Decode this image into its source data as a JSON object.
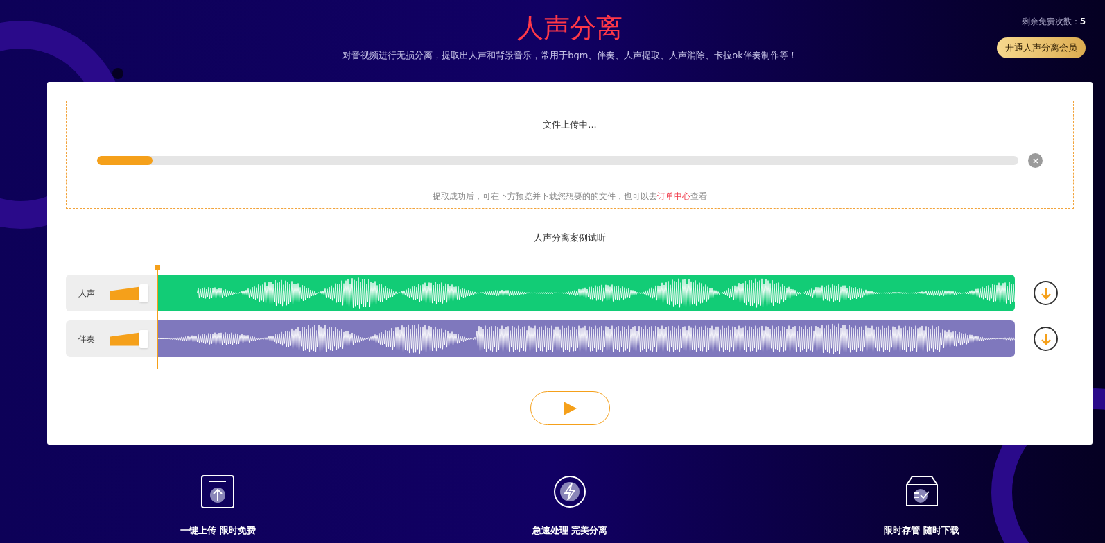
{
  "header": {
    "title": "人声分离",
    "subtitle": "对音视频进行无损分离，提取出人声和背景音乐，常用于bgm、伴奏、人声提取、人声消除、卡拉ok伴奏制作等！",
    "remaining_label": "剩余免费次数：",
    "remaining_count": "5",
    "member_button": "开通人声分离会员"
  },
  "upload": {
    "status": "文件上传中...",
    "level": 0.06,
    "hint_before": "提取成功后，可在下方预览并下载您想要的的文件，也可以去",
    "hint_link": "订单中心",
    "hint_after": "查看"
  },
  "demo": {
    "title": "人声分离案例试听",
    "tracks": [
      {
        "name": "人声",
        "level": 0.9,
        "color": "#12cc76"
      },
      {
        "name": "伴奏",
        "level": 0.9,
        "color": "#7f78bd"
      }
    ]
  },
  "features": [
    {
      "kind": "upload",
      "label": "一键上传 限时免费"
    },
    {
      "kind": "speed",
      "label": "急速处理 完美分离"
    },
    {
      "kind": "storage",
      "label": "限时存管 随时下载"
    }
  ]
}
